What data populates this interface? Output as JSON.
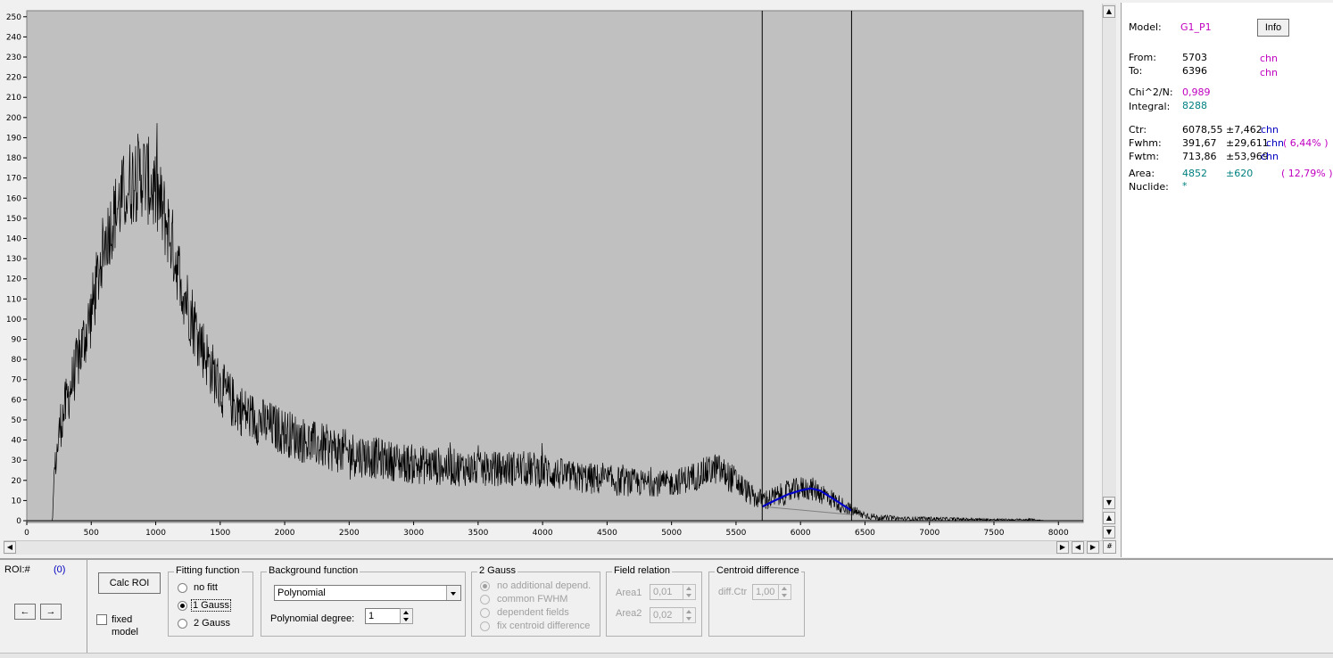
{
  "chart_data": {
    "type": "line",
    "x_ticks": [
      0,
      500,
      1000,
      1500,
      2000,
      2500,
      3000,
      3500,
      4000,
      4500,
      5000,
      5500,
      6000,
      6500,
      7000,
      7500,
      8000
    ],
    "y_ticks": [
      0,
      10,
      20,
      30,
      40,
      50,
      60,
      70,
      80,
      90,
      100,
      110,
      120,
      130,
      140,
      150,
      160,
      170,
      180,
      190,
      200,
      210,
      220,
      230,
      240,
      250
    ],
    "xlim": [
      0,
      8192
    ],
    "ylim": [
      0,
      253
    ],
    "spectrum_envelope": {
      "x": [
        0,
        200,
        210,
        260,
        400,
        500,
        600,
        700,
        800,
        900,
        1000,
        1100,
        1200,
        1300,
        1400,
        1500,
        1600,
        1700,
        1800,
        2000,
        2200,
        2500,
        2800,
        3000,
        3300,
        3500,
        3800,
        4000,
        4200,
        4500,
        4800,
        5000,
        5200,
        5350,
        5500,
        5650,
        5750,
        5900,
        6000,
        6080,
        6200,
        6300,
        6450,
        6600,
        6800,
        7000,
        7500,
        7800,
        7900,
        8192
      ],
      "upper": [
        0,
        0,
        28,
        60,
        95,
        120,
        155,
        175,
        190,
        195,
        185,
        165,
        135,
        115,
        95,
        80,
        72,
        66,
        62,
        56,
        50,
        45,
        40,
        38,
        36,
        34,
        35,
        34,
        30,
        28,
        25,
        25,
        30,
        34,
        27,
        16,
        16,
        20,
        22,
        22,
        18,
        13,
        6,
        3,
        2,
        2,
        1,
        1,
        0,
        0
      ],
      "lower": [
        0,
        0,
        15,
        35,
        65,
        85,
        120,
        135,
        145,
        150,
        140,
        125,
        100,
        80,
        65,
        52,
        45,
        40,
        37,
        32,
        27,
        22,
        20,
        18,
        17,
        17,
        17,
        16,
        14,
        12,
        12,
        12,
        15,
        18,
        12,
        6,
        5,
        8,
        10,
        10,
        7,
        4,
        1,
        0,
        0,
        0,
        0,
        0,
        0,
        0
      ]
    },
    "fit": {
      "x": [
        5703,
        5800,
        5900,
        6000,
        6078,
        6150,
        6250,
        6396
      ],
      "y": [
        7,
        10,
        13,
        15,
        16,
        15,
        11,
        5
      ]
    },
    "background_line": {
      "x": [
        5703,
        6396
      ],
      "y": [
        7,
        3
      ]
    },
    "roi_markers": [
      5703,
      6396
    ]
  },
  "info": {
    "model_label": "Model:",
    "model_value": "G1_P1",
    "info_button": "Info",
    "from_label": "From:",
    "from_value": "5703",
    "from_unit": "chn",
    "to_label": "To:",
    "to_value": "6396",
    "to_unit": "chn",
    "chi_label": "Chi^2/N:",
    "chi_value": "0,989",
    "integral_label": "Integral:",
    "integral_value": "8288",
    "ctr_label": "Ctr:",
    "ctr_value": "6078,55",
    "ctr_err": "±7,462",
    "ctr_unit": "chn",
    "fwhm_label": "Fwhm:",
    "fwhm_value": "391,67",
    "fwhm_err": "±29,611",
    "fwhm_unit": "chn",
    "fwhm_pct": "( 6,44% )",
    "fwtm_label": "Fwtm:",
    "fwtm_value": "713,86",
    "fwtm_err": "±53,969",
    "fwtm_unit": "chn",
    "area_label": "Area:",
    "area_value": "4852",
    "area_err": "±620",
    "area_pct": "( 12,79% )",
    "nuclide_label": "Nuclide:",
    "nuclide_value": "*"
  },
  "scroll": {
    "up": "▲",
    "down": "▼",
    "left": "◀",
    "right": "▶",
    "corner": "#"
  },
  "bottom": {
    "roi_label": "ROI:#",
    "roi_value": "(0)",
    "prev_arrow": "←",
    "next_arrow": "→",
    "calc_roi": "Calc ROI",
    "fixed_model": "fixed model",
    "fitting": {
      "title": "Fitting function",
      "options": [
        "no fitt",
        "1 Gauss",
        "2 Gauss"
      ],
      "selected": "1 Gauss"
    },
    "background": {
      "title": "Background function",
      "selected": "Polynomial",
      "degree_label": "Polynomial degree:",
      "degree_value": "1"
    },
    "two_gauss": {
      "title": "2 Gauss",
      "options": [
        "no additional depend.",
        "common FWHM",
        "dependent fields",
        "fix centroid difference"
      ]
    },
    "field_relation": {
      "title": "Field relation",
      "area1_label": "Area1",
      "area1_value": "0,01",
      "area2_label": "Area2",
      "area2_value": "0,02"
    },
    "centroid": {
      "title": "Centroid difference",
      "label": "diff.Ctr",
      "value": "1,00"
    }
  }
}
